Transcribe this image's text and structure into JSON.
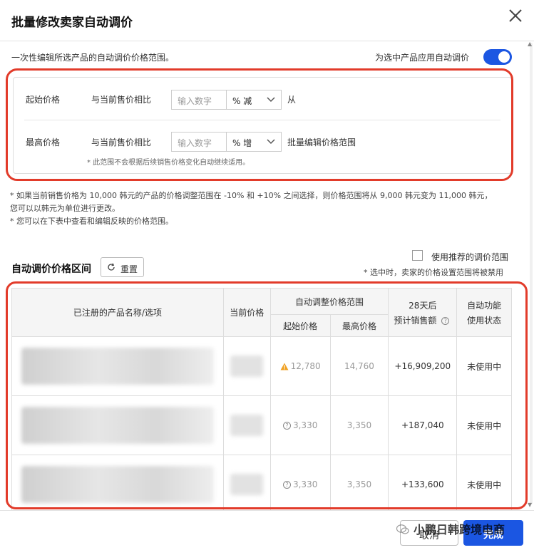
{
  "header": {
    "title": "批量修改卖家自动调价"
  },
  "intro": {
    "text": "一次性编辑所选产品的自动调价价格范围。",
    "toggle_label": "为选中产品应用自动调价",
    "toggle_on": true
  },
  "range": {
    "start": {
      "label": "起始价格",
      "compare": "与当前售价相比",
      "placeholder": "输入数字",
      "unit_select": "% 减",
      "suffix": "从"
    },
    "max": {
      "label": "最高价格",
      "compare": "与当前售价相比",
      "placeholder": "输入数字",
      "unit_select": "% 增",
      "suffix": "批量编辑价格范围"
    },
    "note": "* 此范围不会根据后续销售价格变化自动继续适用。"
  },
  "notes": [
    "* 如果当前销售价格为 10,000 韩元的产品的价格调整范围在 -10% 和 +10% 之间选择，则价格范围将从 9,000 韩元变为 11,000 韩元，",
    "您可以以韩元为单位进行更改。",
    "* 您可以在下表中查看和编辑反映的价格范围。"
  ],
  "section": {
    "title": "自动调价价格区间",
    "reset": "重置",
    "checkbox_label": "使用推荐的调价范围",
    "checkbox_note": "* 选中时，卖家的价格设置范围将被禁用"
  },
  "table": {
    "headers": {
      "product": "已注册的产品名称/选项",
      "current_price": "当前价格",
      "auto_range": "自动调整价格范围",
      "start": "起始价格",
      "max": "最高价格",
      "sales_line1": "28天后",
      "sales_line2": "预计销售额",
      "status_line1": "自动功能",
      "status_line2": "使用状态"
    },
    "rows": [
      {
        "start": "12,780",
        "max": "14,760",
        "sales": "+16,909,200",
        "status": "未使用中",
        "icon": "warning"
      },
      {
        "start": "3,330",
        "max": "3,350",
        "sales": "+187,040",
        "status": "未使用中",
        "icon": "question"
      },
      {
        "start": "3,330",
        "max": "3,350",
        "sales": "+133,600",
        "status": "未使用中",
        "icon": "question"
      }
    ]
  },
  "footer": {
    "cancel": "取消",
    "done": "完成",
    "watermark": "小鹏日韩跨境电商"
  },
  "colors": {
    "accent": "#1b56e2",
    "highlight": "#e23b2a",
    "warning": "#f0a020"
  }
}
